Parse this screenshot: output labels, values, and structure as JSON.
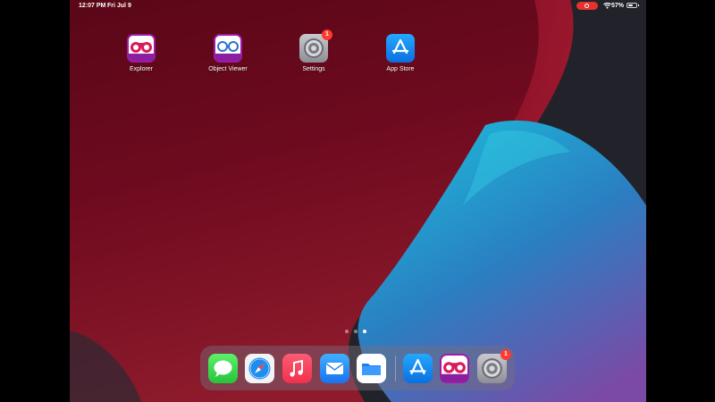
{
  "status_bar": {
    "time": "12:07 PM",
    "date": "Fri Jul 9",
    "battery": "57%",
    "battery_level": 0.57
  },
  "home_apps": [
    {
      "label": "Explorer",
      "icon": "binoculars-icon"
    },
    {
      "label": "Object Viewer",
      "icon": "glasses-icon"
    },
    {
      "label": "Settings",
      "icon": "gear-icon",
      "badge": "1"
    },
    {
      "label": "App Store",
      "icon": "app-store-icon"
    }
  ],
  "page_indicator": {
    "pages": 3,
    "current": 3
  },
  "dock": {
    "apps": [
      "Messages",
      "Safari",
      "Music",
      "Mail",
      "Files"
    ],
    "recent": [
      "App Store",
      "Explorer",
      "Settings"
    ],
    "settings_badge": "1"
  },
  "colors": {
    "accent": "#0a84ff",
    "badge": "#ff3b30",
    "record": "#e5322d"
  }
}
